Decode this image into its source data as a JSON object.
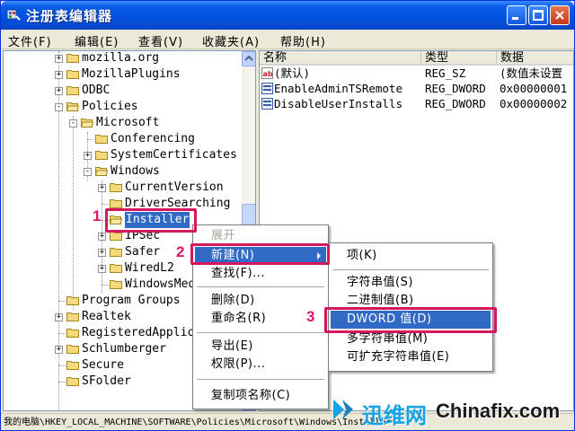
{
  "window": {
    "title": "注册表编辑器"
  },
  "menubar": {
    "file": "文件(F)",
    "edit": "编辑(E)",
    "view": "查看(V)",
    "favorites": "收藏夹(A)",
    "help": "帮助(H)"
  },
  "tree": {
    "items": [
      {
        "label": "mozilla.org",
        "expander": "+"
      },
      {
        "label": "MozillaPlugins",
        "expander": "+"
      },
      {
        "label": "ODBC",
        "expander": "+"
      },
      {
        "label": "Policies",
        "expander": "-"
      },
      {
        "label": "Microsoft",
        "expander": "-"
      },
      {
        "label": "Conferencing",
        "expander": ""
      },
      {
        "label": "SystemCertificates",
        "expander": "+"
      },
      {
        "label": "Windows",
        "expander": "-"
      },
      {
        "label": "CurrentVersion",
        "expander": "+"
      },
      {
        "label": "DriverSearching",
        "expander": ""
      },
      {
        "label": "Installer",
        "expander": ""
      },
      {
        "label": "IPSec",
        "expander": "+"
      },
      {
        "label": "Safer",
        "expander": "+"
      },
      {
        "label": "WiredL2",
        "expander": "+"
      },
      {
        "label": "WindowsMedia",
        "expander": ""
      },
      {
        "label": "Program Groups",
        "expander": ""
      },
      {
        "label": "Realtek",
        "expander": "+"
      },
      {
        "label": "RegisteredApplic",
        "expander": ""
      },
      {
        "label": "Schlumberger",
        "expander": "+"
      },
      {
        "label": "Secure",
        "expander": ""
      },
      {
        "label": "SFolder",
        "expander": ""
      }
    ]
  },
  "values": {
    "headers": {
      "name": "名称",
      "type": "类型",
      "data": "数据"
    },
    "rows": [
      {
        "name": "(默认)",
        "type": "REG_SZ",
        "data": "(数值未设置"
      },
      {
        "name": "EnableAdminTSRemote",
        "type": "REG_DWORD",
        "data": "0x00000001"
      },
      {
        "name": "DisableUserInstalls",
        "type": "REG_DWORD",
        "data": "0x00000002"
      }
    ]
  },
  "context_menu": {
    "expand": "展开",
    "new": "新建(N)",
    "find": "查找(F)...",
    "delete": "删除(D)",
    "rename": "重命名(R)",
    "export": "导出(E)",
    "permissions": "权限(P)...",
    "copy_key_name": "复制项名称(C)"
  },
  "submenu": {
    "key": "项(K)",
    "string": "字符串值(S)",
    "binary": "二进制值(B)",
    "dword": "DWORD 值(D)",
    "multi_string": "多字符串值(M)",
    "expandable_string": "可扩充字符串值(E)"
  },
  "annotations": {
    "step1": "1",
    "step2": "2",
    "step3": "3"
  },
  "statusbar": {
    "path": "我的电脑\\HKEY_LOCAL_MACHINE\\SOFTWARE\\Policies\\Microsoft\\Windows\\Installer"
  },
  "watermark": {
    "brand_cn": "迅维网",
    "brand_en": "Chinafix.com"
  },
  "colors": {
    "selection": "#316ac5",
    "annotation": "#d6175f"
  }
}
